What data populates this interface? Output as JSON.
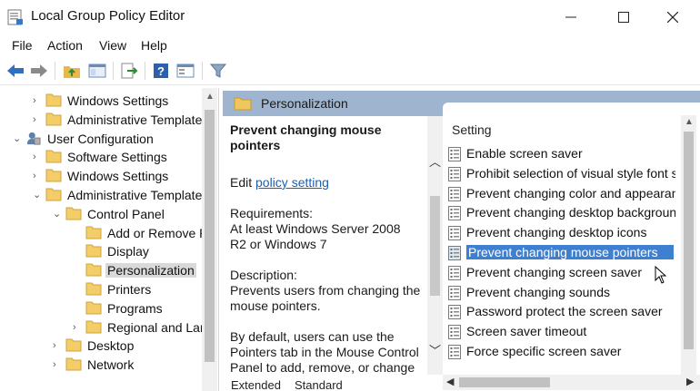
{
  "window": {
    "title": "Local Group Policy Editor"
  },
  "menu": [
    "File",
    "Action",
    "View",
    "Help"
  ],
  "tree": {
    "items": [
      {
        "label": "Windows Settings",
        "level": 2,
        "chevron": "›"
      },
      {
        "label": "Administrative Template",
        "level": 2,
        "chevron": "›"
      },
      {
        "label": "User Configuration",
        "level": 1,
        "chevron": "⌄"
      },
      {
        "label": "Software Settings",
        "level": 2,
        "chevron": "›"
      },
      {
        "label": "Windows Settings",
        "level": 2,
        "chevron": "›"
      },
      {
        "label": "Administrative Template",
        "level": 2,
        "chevron": "⌄"
      },
      {
        "label": "Control Panel",
        "level": 3,
        "chevron": "⌄"
      },
      {
        "label": "Add or Remove P",
        "level": 4,
        "chevron": ""
      },
      {
        "label": "Display",
        "level": 4,
        "chevron": ""
      },
      {
        "label": "Personalization",
        "level": 4,
        "chevron": "",
        "selected": true
      },
      {
        "label": "Printers",
        "level": 4,
        "chevron": ""
      },
      {
        "label": "Programs",
        "level": 4,
        "chevron": ""
      },
      {
        "label": "Regional and Lar",
        "level": 4,
        "chevron": "›"
      },
      {
        "label": "Desktop",
        "level": 3,
        "chevron": "›"
      },
      {
        "label": "Network",
        "level": 3,
        "chevron": "›"
      }
    ]
  },
  "header": {
    "title": "Personalization"
  },
  "description": {
    "policy_title": "Prevent changing mouse pointers",
    "edit_prefix": "Edit ",
    "edit_link": "policy setting",
    "requirements_label": "Requirements:",
    "requirements_text": "At least Windows Server 2008 R2 or Windows 7",
    "description_label": "Description:",
    "description_text": "Prevents users from changing the mouse pointers.",
    "default_text": "By default, users can use the Pointers tab in the Mouse Control Panel to add, remove, or change the mouse pointers."
  },
  "list": {
    "header": "Setting",
    "items": [
      {
        "label": "Enable screen saver"
      },
      {
        "label": "Prohibit selection of visual style font si"
      },
      {
        "label": "Prevent changing color and appearanc"
      },
      {
        "label": "Prevent changing desktop backgroun"
      },
      {
        "label": "Prevent changing desktop icons"
      },
      {
        "label": "Prevent changing mouse pointers",
        "selected": true
      },
      {
        "label": "Prevent changing screen saver"
      },
      {
        "label": "Prevent changing sounds"
      },
      {
        "label": "Password protect the screen saver"
      },
      {
        "label": "Screen saver timeout"
      },
      {
        "label": "Force specific screen saver"
      }
    ]
  },
  "tabs": [
    "Extended",
    "Standard"
  ],
  "colors": {
    "header_bar": "#9fb4ce",
    "selection": "#3e7fd0",
    "link": "#1a5fb4"
  }
}
